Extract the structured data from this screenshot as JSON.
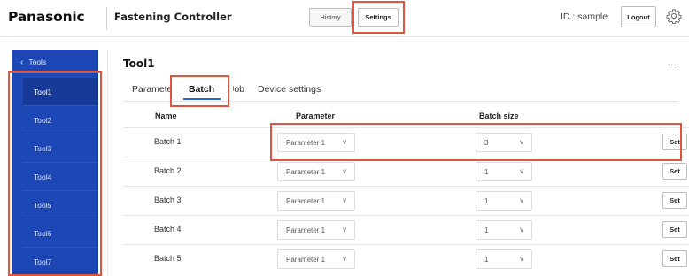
{
  "header": {
    "brand": "Panasonic",
    "app_title": "Fastening Controller",
    "history_label": "History",
    "settings_label": "Settings",
    "user_id": "ID : sample",
    "logout_label": "Logout",
    "settings_icon": "gear-icon"
  },
  "sidebar": {
    "back_label": "Tools",
    "back_icon": "chevron-left-icon",
    "items": [
      {
        "label": "Tool1",
        "active": true
      },
      {
        "label": "Tool2"
      },
      {
        "label": "Tool3"
      },
      {
        "label": "Tool4"
      },
      {
        "label": "Tool5"
      },
      {
        "label": "Tool6"
      },
      {
        "label": "Tool7"
      }
    ]
  },
  "main": {
    "title": "Tool1",
    "more_label": "...",
    "tabs": [
      {
        "label": "Parameter"
      },
      {
        "label": "Batch",
        "active": true
      },
      {
        "label": "Job"
      },
      {
        "label": "Device settings"
      }
    ],
    "columns": {
      "name": "Name",
      "parameter": "Parameter",
      "batch_size": "Batch size"
    },
    "rows": [
      {
        "name": "Batch 1",
        "parameter": "Parameter 1",
        "batch_size": "3",
        "set_label": "Set"
      },
      {
        "name": "Batch 2",
        "parameter": "Parameter 1",
        "batch_size": "1",
        "set_label": "Set"
      },
      {
        "name": "Batch 3",
        "parameter": "Parameter 1",
        "batch_size": "1",
        "set_label": "Set"
      },
      {
        "name": "Batch 4",
        "parameter": "Parameter 1",
        "batch_size": "1",
        "set_label": "Set"
      },
      {
        "name": "Batch 5",
        "parameter": "Parameter 1",
        "batch_size": "1",
        "set_label": "Set"
      }
    ]
  },
  "colors": {
    "sidebar": "#1d47b4",
    "highlight": "#e2553d",
    "tab_accent": "#2a64d0"
  }
}
